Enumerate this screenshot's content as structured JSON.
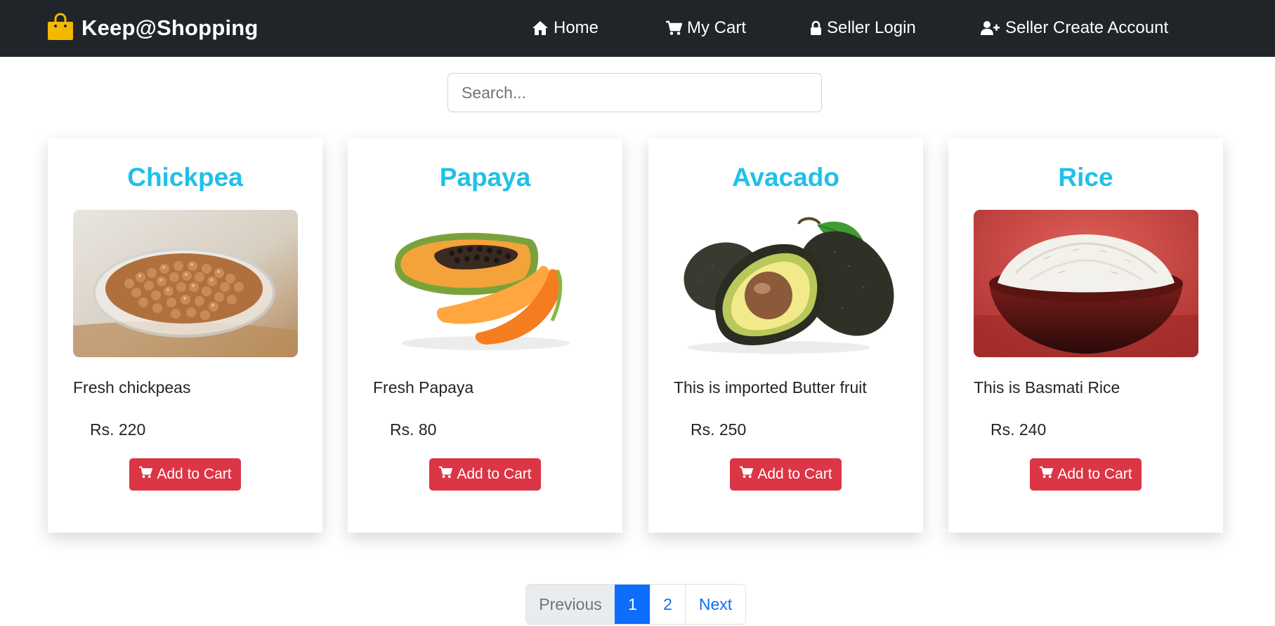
{
  "navbar": {
    "brand": "Keep@Shopping",
    "links": {
      "home": "Home",
      "cart": "My Cart",
      "login": "Seller Login",
      "create": "Seller Create Account"
    }
  },
  "search": {
    "placeholder": "Search..."
  },
  "products": [
    {
      "title": "Chickpea",
      "description": "Fresh chickpeas",
      "price": "Rs. 220",
      "button": "Add to Cart",
      "image": "chickpeas-photo"
    },
    {
      "title": "Papaya",
      "description": "Fresh Papaya",
      "price": "Rs. 80",
      "button": "Add to Cart",
      "image": "papaya-photo"
    },
    {
      "title": "Avacado",
      "description": "This is imported Butter fruit",
      "price": "Rs. 250",
      "button": "Add to Cart",
      "image": "avocado-photo"
    },
    {
      "title": "Rice",
      "description": "This is Basmati Rice",
      "price": "Rs. 240",
      "button": "Add to Cart",
      "image": "rice-photo"
    }
  ],
  "pagination": {
    "previous": "Previous",
    "pages": [
      "1",
      "2"
    ],
    "next": "Next",
    "active": "1"
  },
  "colors": {
    "navbar_bg": "#212529",
    "title_accent": "#1fc0e8",
    "button_red": "#dc3545",
    "page_active": "#0d6efd",
    "brand_bag": "#f5b800"
  }
}
